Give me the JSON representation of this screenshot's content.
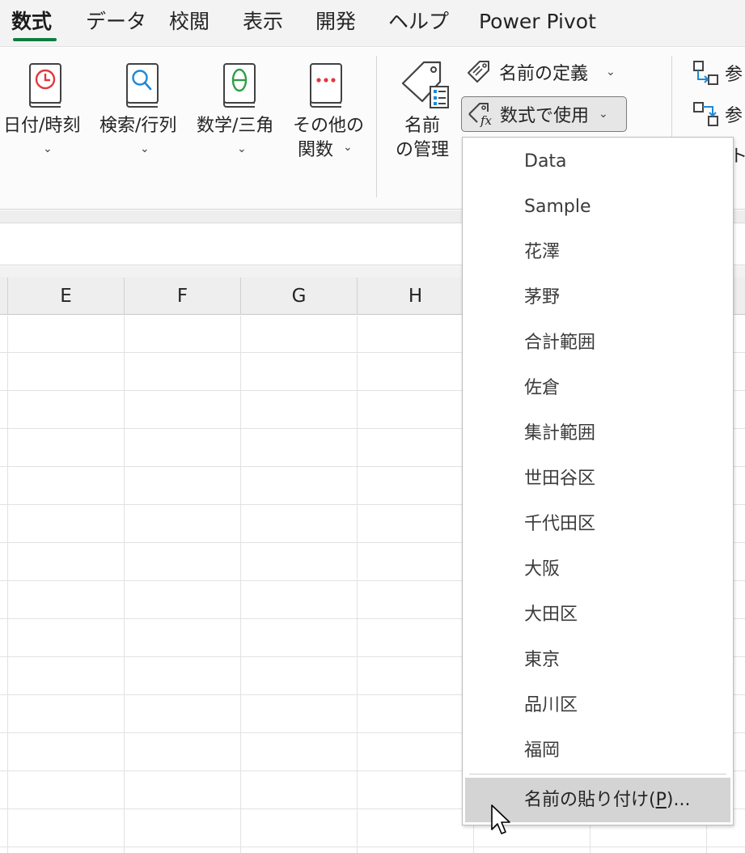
{
  "tabs": [
    {
      "label": "数式",
      "active": true
    },
    {
      "label": "データ"
    },
    {
      "label": "校閲"
    },
    {
      "label": "表示"
    },
    {
      "label": "開発"
    },
    {
      "label": "ヘルプ"
    },
    {
      "label": "Power Pivot"
    }
  ],
  "ribbon": {
    "library": [
      {
        "label": "日付/時刻",
        "icon": "clock-book-icon"
      },
      {
        "label": "検索/行列",
        "icon": "magnifier-book-icon"
      },
      {
        "label": "数学/三角",
        "icon": "theta-book-icon"
      },
      {
        "label_line1": "その他の",
        "label_line2": "関数",
        "icon": "more-dots-book-icon"
      }
    ],
    "name_manager": {
      "line1": "名前",
      "line2": "の管理"
    },
    "define_name": "名前の定義",
    "use_in_formula": "数式で使用",
    "trace_precedents": "参",
    "trace_dependents": "参",
    "remove_arrows_partial": "ト"
  },
  "sheet": {
    "columns": [
      "E",
      "F",
      "G",
      "H"
    ]
  },
  "dropdown": {
    "items": [
      "Data",
      "Sample",
      "花澤",
      "茅野",
      "合計範囲",
      "佐倉",
      "集計範囲",
      "世田谷区",
      "千代田区",
      "大阪",
      "大田区",
      "東京",
      "品川区",
      "福岡"
    ],
    "paste_names": {
      "before": "名前の貼り付け(",
      "mnemonic": "P",
      "after": ")..."
    }
  },
  "colors": {
    "accent_green": "#107c41",
    "clock_red": "#e0393e",
    "search_blue": "#1e88d6",
    "theta_green": "#2e9e48",
    "dots_red": "#e0393e"
  }
}
